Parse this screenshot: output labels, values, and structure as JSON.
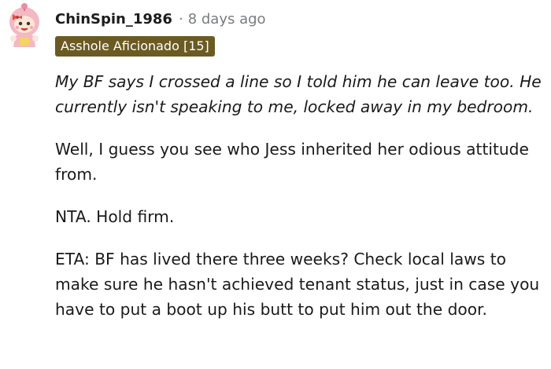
{
  "comment": {
    "username": "ChinSpin_1986",
    "separator": "·",
    "timestamp": "8 days ago",
    "flair": "Asshole Aficionado [15]",
    "flair_color": "#6b5b23",
    "avatar_icon": "snoo-avatar-pink-hood-icon",
    "paragraphs": [
      "My BF says I crossed a line so I told him he can leave too. He currently isn't speaking to me, locked away in my bedroom.",
      "Well, I guess you see who Jess inherited her odious attitude from.",
      "NTA. Hold firm.",
      "ETA: BF has lived there three weeks? Check local laws to make sure he hasn't achieved tenant status, just in case you have to put a boot up his butt to put him out the door."
    ]
  }
}
